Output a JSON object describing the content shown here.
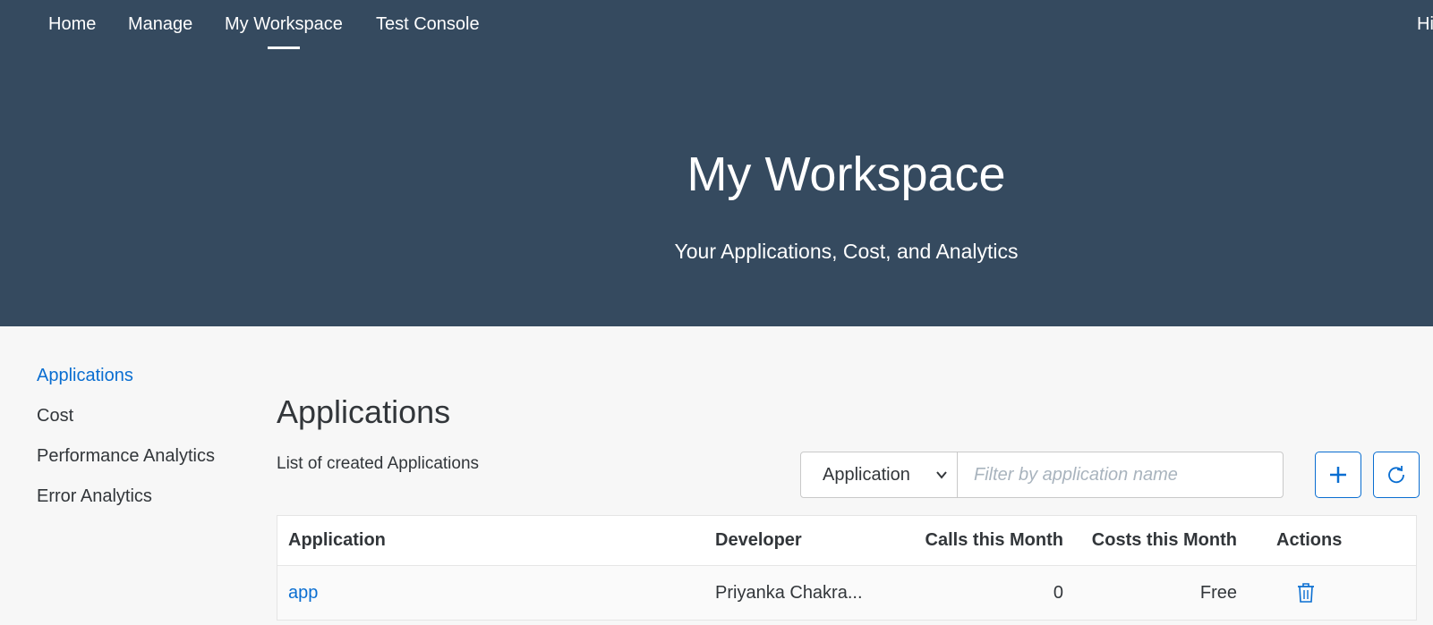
{
  "nav": {
    "items": [
      {
        "label": "Home"
      },
      {
        "label": "Manage"
      },
      {
        "label": "My Workspace"
      },
      {
        "label": "Test Console"
      }
    ],
    "active": "My Workspace",
    "greeting": "Hi"
  },
  "hero": {
    "title": "My Workspace",
    "subtitle": "Your Applications, Cost, and Analytics"
  },
  "sidebar": {
    "items": [
      {
        "label": "Applications"
      },
      {
        "label": "Cost"
      },
      {
        "label": "Performance Analytics"
      },
      {
        "label": "Error Analytics"
      }
    ],
    "active": "Applications"
  },
  "main": {
    "title": "Applications",
    "subtitle": "List of created Applications",
    "filter": {
      "select_value": "Application",
      "placeholder": "Filter by application name"
    },
    "table": {
      "columns": [
        "Application",
        "Developer",
        "Calls this Month",
        "Costs this Month",
        "Actions"
      ],
      "rows": [
        {
          "application": "app",
          "developer": "Priyanka Chakra...",
          "calls": "0",
          "costs": "Free",
          "action_icon": "trash-icon"
        }
      ]
    }
  },
  "colors": {
    "header_bg": "#354a5f",
    "accent": "#0a6ed1",
    "page_bg": "#f7f7f7"
  }
}
